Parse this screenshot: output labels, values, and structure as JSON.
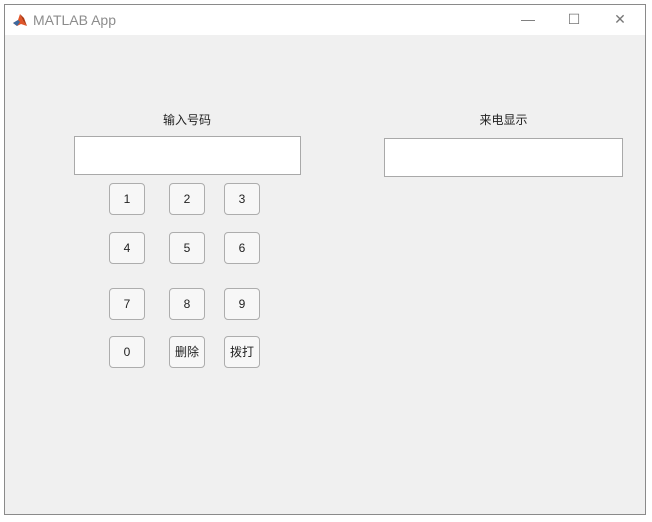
{
  "window": {
    "title": "MATLAB App",
    "app_icon": "matlab-logo-icon"
  },
  "window_controls": {
    "minimize": "—",
    "maximize": "☐",
    "close": "✕"
  },
  "dial_section": {
    "label": "输入号码",
    "input_value": ""
  },
  "caller_section": {
    "label": "来电显示",
    "input_value": ""
  },
  "keypad": {
    "key_1": "1",
    "key_2": "2",
    "key_3": "3",
    "key_4": "4",
    "key_5": "5",
    "key_6": "6",
    "key_7": "7",
    "key_8": "8",
    "key_9": "9",
    "key_0": "0",
    "delete": "删除",
    "dial": "拨打"
  },
  "colors": {
    "window_bg": "#f0f0f0",
    "titlebar_bg": "#ffffff",
    "field_border": "#a9a9a9"
  }
}
